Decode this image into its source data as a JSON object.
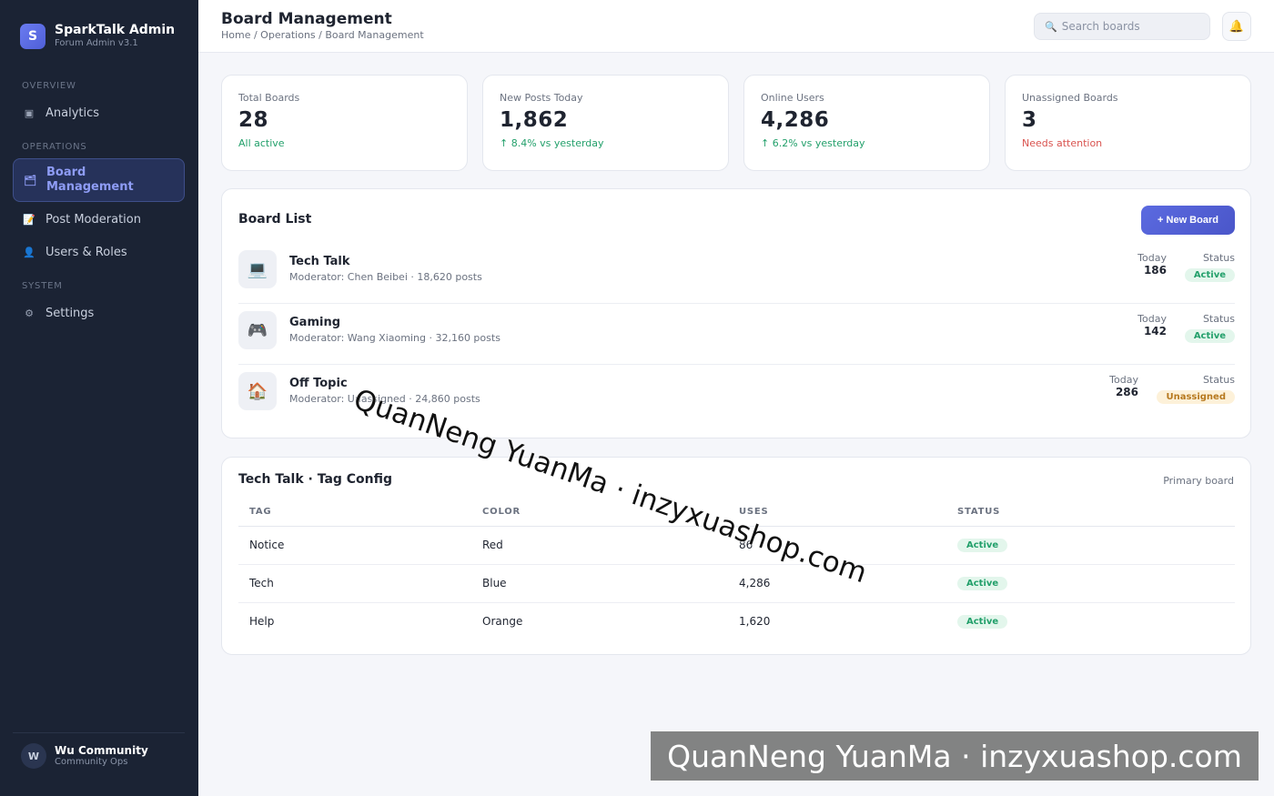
{
  "sidebar": {
    "brand_initial": "S",
    "brand_name": "SparkTalk Admin",
    "brand_sub": "Forum Admin v3.1",
    "sections": {
      "overview": "OVERVIEW",
      "operations": "OPERATIONS",
      "system": "SYSTEM"
    },
    "items": {
      "analytics": {
        "label": "Analytics",
        "icon": "chart-icon",
        "glyph": "▣"
      },
      "board_management": {
        "label": "Board Management",
        "icon": "folder-icon",
        "glyph": "🗂"
      },
      "post_moderation": {
        "label": "Post Moderation",
        "icon": "memo-icon",
        "glyph": "📝"
      },
      "users_roles": {
        "label": "Users & Roles",
        "icon": "user-icon",
        "glyph": "👤"
      },
      "settings": {
        "label": "Settings",
        "icon": "gear-icon",
        "glyph": "⚙"
      }
    },
    "user": {
      "initial": "W",
      "name": "Wu Community",
      "role": "Community Ops"
    }
  },
  "header": {
    "title": "Board Management",
    "breadcrumb": "Home / Operations / Board Management",
    "search_placeholder": "Search boards",
    "search_glyph": "🔍",
    "bell_glyph": "🔔"
  },
  "stats": [
    {
      "label": "Total Boards",
      "value": "28",
      "note": "All active"
    },
    {
      "label": "New Posts Today",
      "value": "1,862",
      "note": "↑ 8.4% vs yesterday"
    },
    {
      "label": "Online Users",
      "value": "4,286",
      "note": "↑ 6.2% vs yesterday"
    },
    {
      "label": "Unassigned Boards",
      "value": "3",
      "note": "Needs attention"
    }
  ],
  "board_list": {
    "title": "Board List",
    "new_button": "+ New Board",
    "today_label": "Today",
    "status_label": "Status",
    "boards": [
      {
        "icon": "laptop-icon",
        "glyph": "💻",
        "name": "Tech Talk",
        "meta": "Moderator: Chen Beibei · 18,620 posts",
        "today": "186",
        "status": "Active"
      },
      {
        "icon": "gamepad-icon",
        "glyph": "🎮",
        "name": "Gaming",
        "meta": "Moderator: Wang Xiaoming · 32,160 posts",
        "today": "142",
        "status": "Active"
      },
      {
        "icon": "house-icon",
        "glyph": "🏠",
        "name": "Off Topic",
        "meta": "Moderator: Unassigned · 24,860 posts",
        "today": "286",
        "status": "Unassigned"
      }
    ]
  },
  "tag_config": {
    "title": "Tech Talk · Tag Config",
    "subtitle": "Primary board",
    "columns": [
      "TAG",
      "COLOR",
      "USES",
      "STATUS"
    ],
    "rows": [
      {
        "tag": "Notice",
        "color": "Red",
        "uses": "86",
        "status": "Active"
      },
      {
        "tag": "Tech",
        "color": "Blue",
        "uses": "4,286",
        "status": "Active"
      },
      {
        "tag": "Help",
        "color": "Orange",
        "uses": "1,620",
        "status": "Active"
      }
    ]
  },
  "watermark": {
    "text": "QuanNeng YuanMa · inzyxuashop.com"
  },
  "colors": {
    "sidebar_bg": "#1b2334",
    "accent": "#5b6ae0",
    "positive": "#23a06b",
    "negative": "#d9534f",
    "warning": "#b7791f"
  }
}
